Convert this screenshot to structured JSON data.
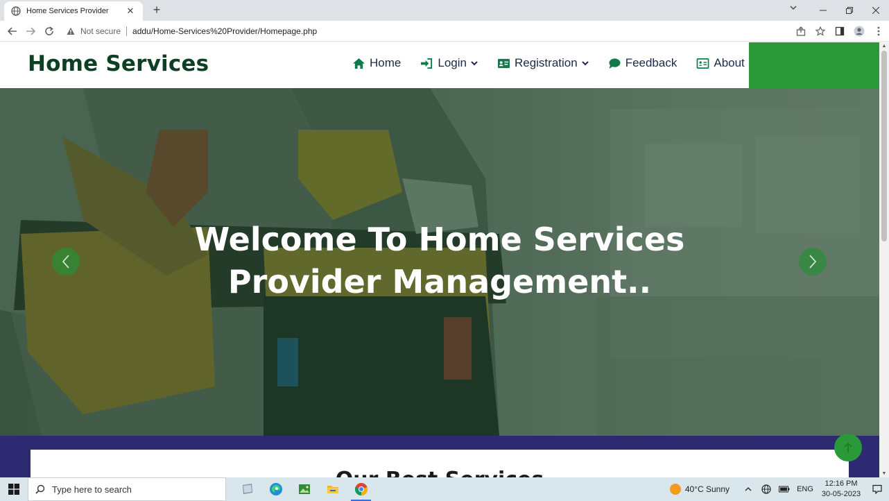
{
  "browser": {
    "tab_title": "Home Services Provider",
    "tab_close": "✕",
    "new_tab": "+",
    "address": {
      "security_label": "Not secure",
      "url": "addu/Home-Services%20Provider/Homepage.php"
    }
  },
  "site": {
    "brand": "Home Services",
    "nav": [
      {
        "label": "Home",
        "icon": "home-icon"
      },
      {
        "label": "Login",
        "icon": "sign-in-icon",
        "has_dropdown": true
      },
      {
        "label": "Registration",
        "icon": "id-card-icon",
        "has_dropdown": true
      },
      {
        "label": "Feedback",
        "icon": "chat-bubble-icon"
      },
      {
        "label": "About",
        "icon": "address-card-icon"
      }
    ],
    "hero": {
      "title_line1": "Welcome To Home Services",
      "title_line2": "Provider Management.."
    },
    "services_heading": "Our Best Services"
  },
  "colors": {
    "brand_text": "#0d3f24",
    "accent_green": "#2a9a38",
    "nav_icon_green": "#0f7a4a",
    "band_navy": "#2e2a72"
  },
  "taskbar": {
    "search_placeholder": "Type here to search",
    "weather": "40°C  Sunny",
    "language": "ENG",
    "time": "12:16 PM",
    "date": "30-05-2023"
  }
}
